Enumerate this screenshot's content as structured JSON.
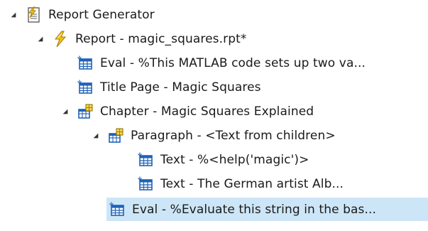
{
  "tree": {
    "nodes": [
      {
        "label": "Report Generator",
        "icon": "report-generator-icon",
        "expanded": true,
        "selected": false
      },
      {
        "label": "Report - magic_squares.rpt*",
        "icon": "report-lightning-icon",
        "expanded": true,
        "selected": false
      },
      {
        "label": "Eval - %This MATLAB code sets up two va...",
        "icon": "table-component-icon",
        "expanded": null,
        "selected": false
      },
      {
        "label": "Title Page - Magic Squares",
        "icon": "table-component-icon",
        "expanded": null,
        "selected": false
      },
      {
        "label": "Chapter - Magic Squares Explained",
        "icon": "chapter-component-icon",
        "expanded": true,
        "selected": false
      },
      {
        "label": "Paragraph - <Text from children>",
        "icon": "chapter-component-icon",
        "expanded": true,
        "selected": false
      },
      {
        "label": "Text - %<help('magic')>",
        "icon": "table-component-icon",
        "expanded": null,
        "selected": false
      },
      {
        "label": "Text - The German artist Alb...",
        "icon": "table-component-icon",
        "expanded": null,
        "selected": false
      },
      {
        "label": "Eval - %Evaluate this string in the bas...",
        "icon": "table-component-icon",
        "expanded": null,
        "selected": true
      }
    ]
  },
  "colors": {
    "selection": "#cde6f7",
    "expander": "#333333",
    "component_icon_blue": "#1e62b8",
    "lightning_yellow": "#f2c21b"
  }
}
